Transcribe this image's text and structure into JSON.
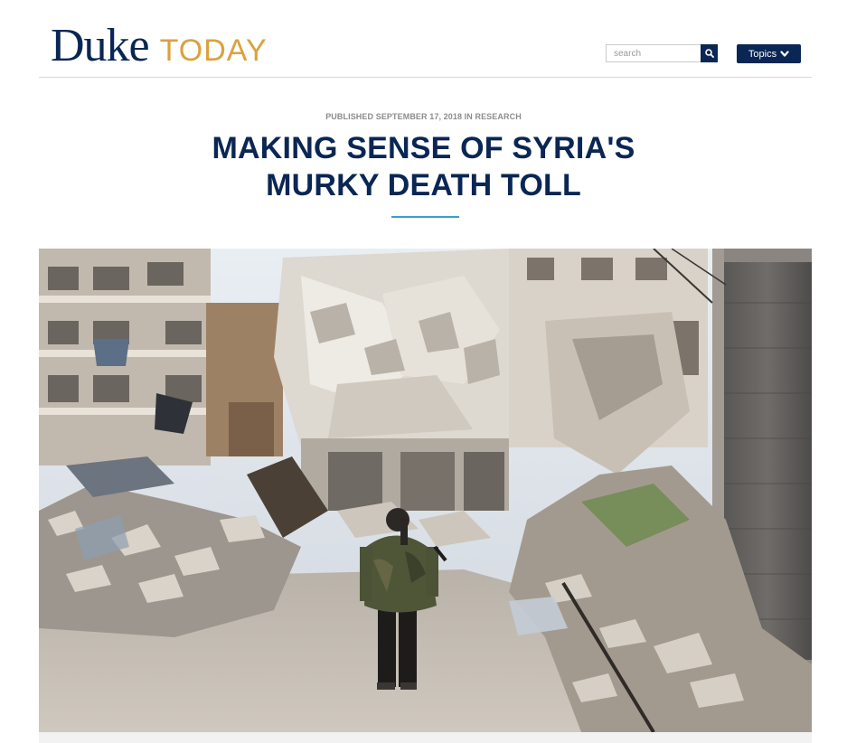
{
  "header": {
    "logo_primary": "Duke",
    "logo_secondary": "TODAY",
    "search_placeholder": "search",
    "search_icon": "magnifier-icon",
    "topics_label": "Topics",
    "topics_icon": "chevron-down-icon"
  },
  "article": {
    "published_label": "PUBLISHED",
    "published_date": "SEPTEMBER 17, 2018",
    "in_label": "IN",
    "category": "RESEARCH",
    "title_line1": "MAKING SENSE OF SYRIA'S",
    "title_line2": "MURKY DEATH TOLL"
  },
  "colors": {
    "brand_navy": "#0a2654",
    "brand_gold": "#d9a23f",
    "accent_blue": "#3aa0cc"
  }
}
